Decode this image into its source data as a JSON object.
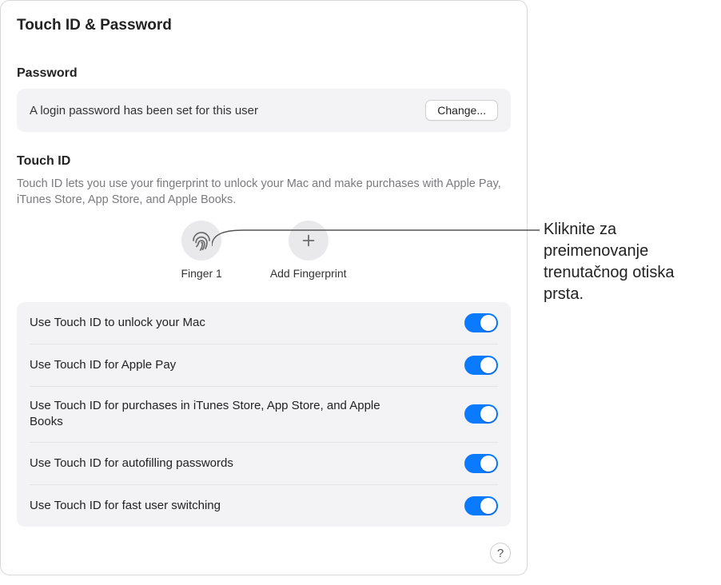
{
  "title": "Touch ID & Password",
  "password": {
    "heading": "Password",
    "status": "A login password has been set for this user",
    "change_label": "Change..."
  },
  "touchid": {
    "heading": "Touch ID",
    "description": "Touch ID lets you use your fingerprint to unlock your Mac and make purchases with Apple Pay, iTunes Store, App Store, and Apple Books.",
    "finger_label": "Finger 1",
    "add_label": "Add Fingerprint"
  },
  "options": [
    {
      "label": "Use Touch ID to unlock your Mac",
      "on": true
    },
    {
      "label": "Use Touch ID for Apple Pay",
      "on": true
    },
    {
      "label": "Use Touch ID for purchases in iTunes Store, App Store, and Apple Books",
      "on": true
    },
    {
      "label": "Use Touch ID for autofilling passwords",
      "on": true
    },
    {
      "label": "Use Touch ID for fast user switching",
      "on": true
    }
  ],
  "help_label": "?",
  "callout": "Kliknite za preimenovanje trenutačnog otiska prsta."
}
